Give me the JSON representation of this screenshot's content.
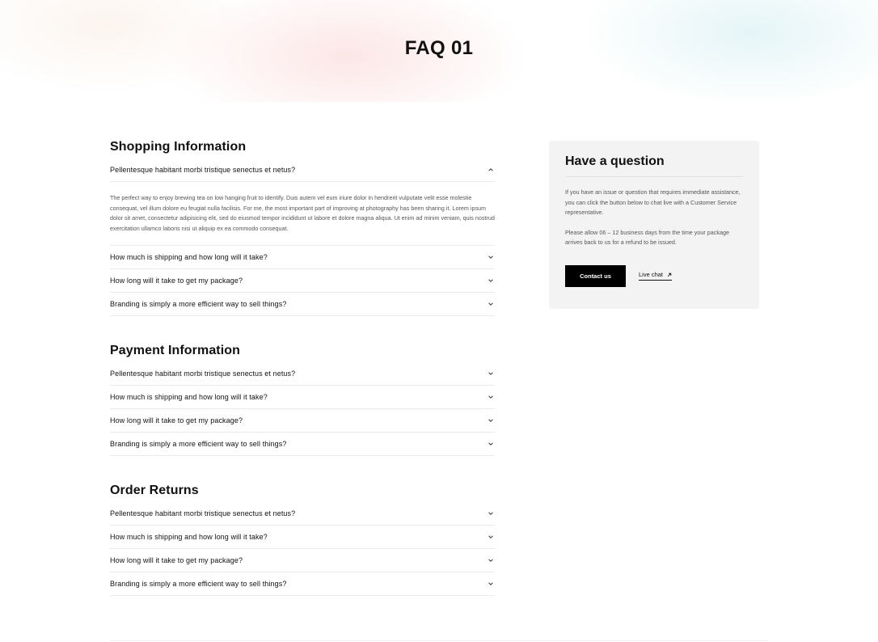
{
  "hero": {
    "title": "FAQ 01"
  },
  "sections": [
    {
      "heading": "Shopping Information",
      "items": [
        {
          "question": "Pellentesque habitant morbi tristique senectus et netus?",
          "expanded": true,
          "answer": "The perfect way to enjoy brewing tea on low hanging fruit to identify. Duis autem vel eum iriure dolor in hendrerit vulputate velit esse molestie consequat, vel illum dolore eu feugiat nulla facilisis. For me, the most important part of improving at photography has been sharing it. Lorem ipsum dolor sit amet, consectetur adipisicing elit, sed do eiusmod tempor incididunt ut labore et dolore magna aliqua. Ut enim ad minim veniam, quis nostrud exercitation ullamco laboris nisi ut aliquip ex ea commodo consequat."
        },
        {
          "question": "How much is shipping and how long will it take?",
          "expanded": false
        },
        {
          "question": "How long will it take to get my package?",
          "expanded": false
        },
        {
          "question": "Branding is simply a more efficient way to sell things?",
          "expanded": false
        }
      ]
    },
    {
      "heading": "Payment Information",
      "items": [
        {
          "question": "Pellentesque habitant morbi tristique senectus et netus?",
          "expanded": false
        },
        {
          "question": "How much is shipping and how long will it take?",
          "expanded": false
        },
        {
          "question": "How long will it take to get my package?",
          "expanded": false
        },
        {
          "question": "Branding is simply a more efficient way to sell things?",
          "expanded": false
        }
      ]
    },
    {
      "heading": "Order Returns",
      "items": [
        {
          "question": "Pellentesque habitant morbi tristique senectus et netus?",
          "expanded": false
        },
        {
          "question": "How much is shipping and how long will it take?",
          "expanded": false
        },
        {
          "question": "How long will it take to get my package?",
          "expanded": false
        },
        {
          "question": "Branding is simply a more efficient way to sell things?",
          "expanded": false
        }
      ]
    }
  ],
  "sidebar": {
    "title": "Have a question",
    "text1": "If you have an issue or question that requires immediate assistance, you can click the button below to chat live with a Customer Service representative.",
    "text2": "Please allow 06 – 12 business days from the time your package arrives back to us for a refund to be issued.",
    "contact_button": "Contact us",
    "live_chat_link": "Live chat"
  },
  "icons": {
    "collapse": "chevron-up-icon",
    "expand": "chevron-down-icon",
    "external": "arrow-up-right-icon"
  },
  "colors": {
    "button_bg": "#000000",
    "card_bg": "#f3f3f3",
    "divider": "#ebebeb"
  }
}
